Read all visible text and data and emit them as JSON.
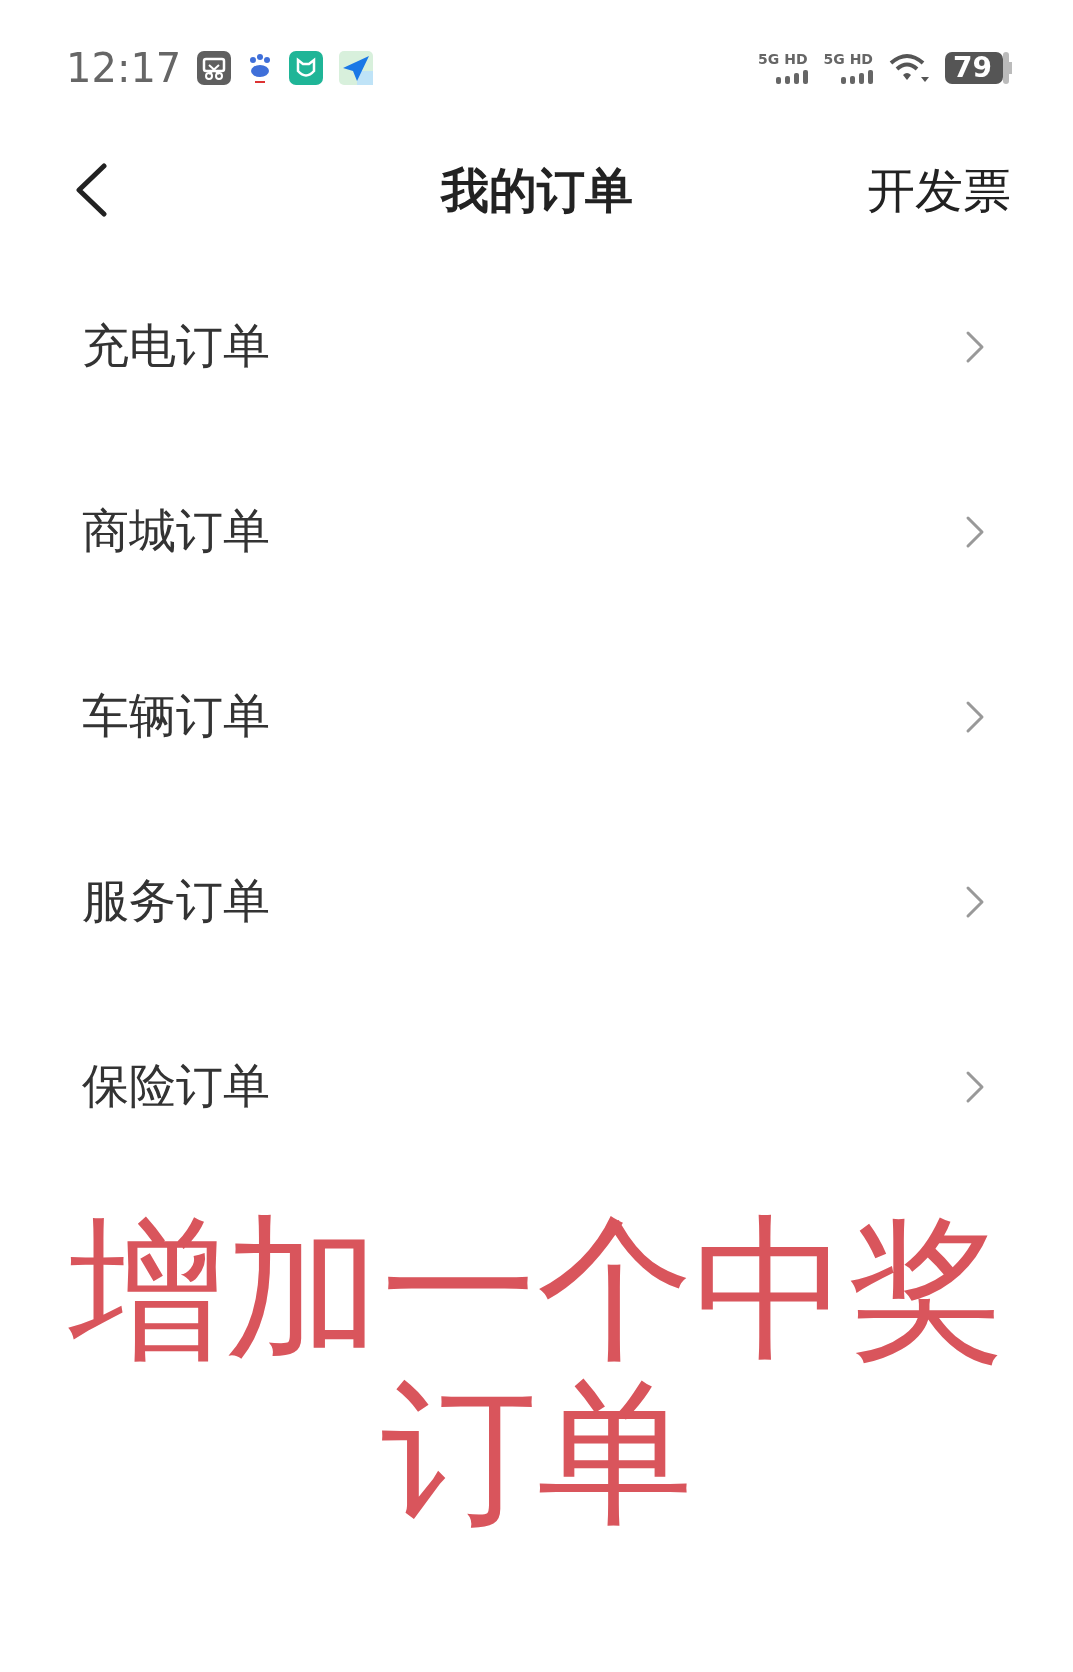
{
  "status_bar": {
    "time": "12:17",
    "signal_labels": [
      "5G HD",
      "5G HD"
    ],
    "battery": "79"
  },
  "header": {
    "title": "我的订单",
    "action": "开发票"
  },
  "menu_items": [
    {
      "label": "充电订单"
    },
    {
      "label": "商城订单"
    },
    {
      "label": "车辆订单"
    },
    {
      "label": "服务订单"
    },
    {
      "label": "保险订单"
    }
  ],
  "caption": "增加一个中奖订单"
}
